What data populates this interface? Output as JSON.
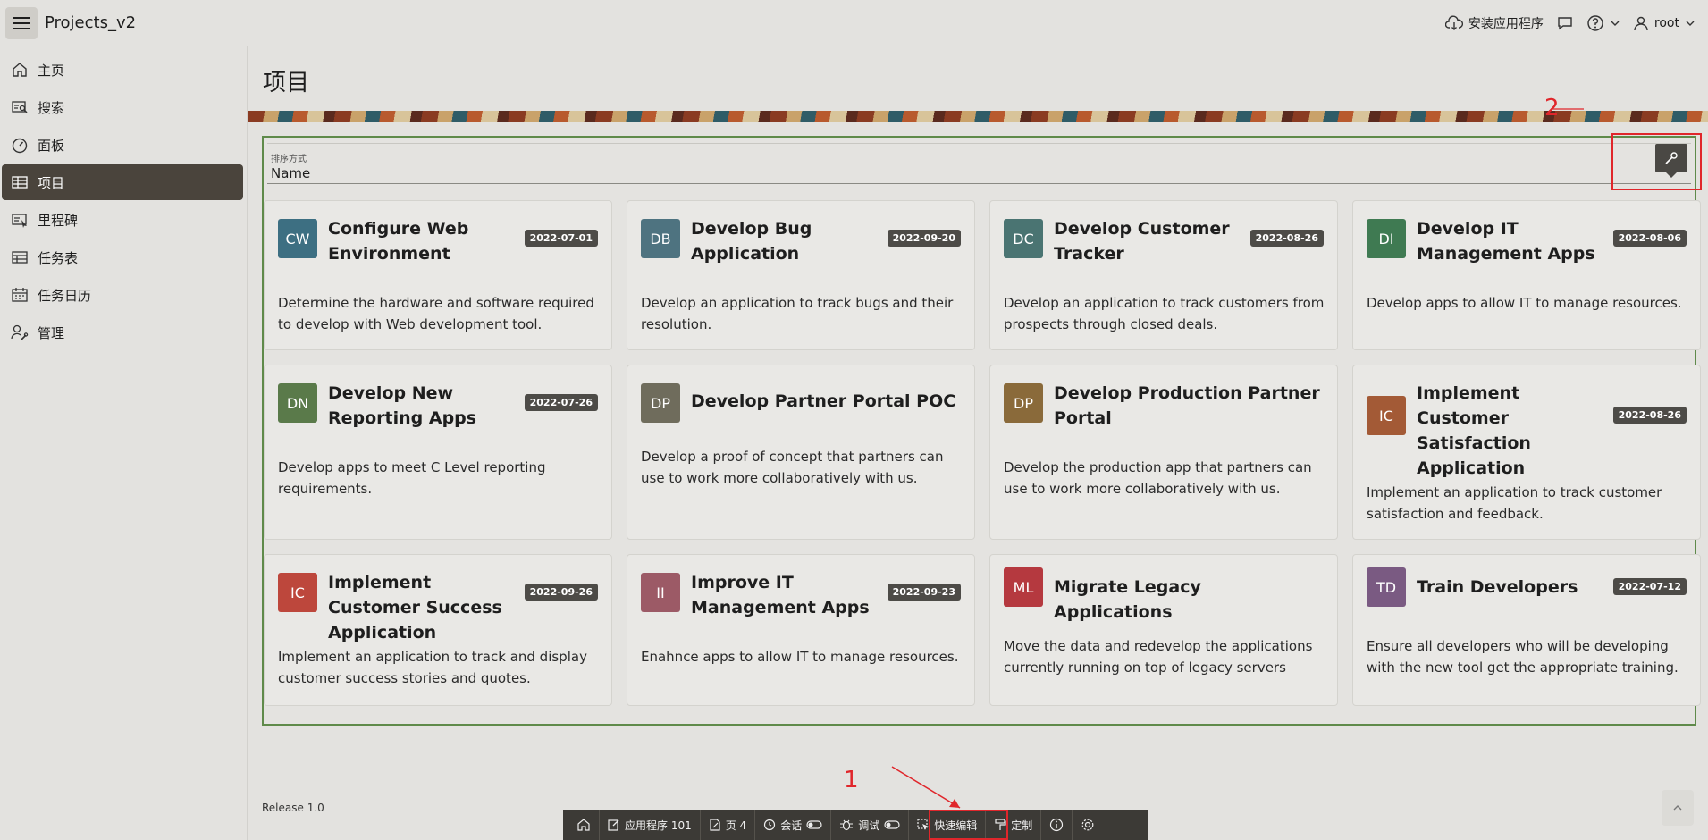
{
  "header": {
    "app_title": "Projects_v2",
    "install_label": "安装应用程序",
    "user_label": "root"
  },
  "sidebar": {
    "items": [
      {
        "label": "主页",
        "icon": "home-icon"
      },
      {
        "label": "搜索",
        "icon": "search-report-icon"
      },
      {
        "label": "面板",
        "icon": "dashboard-icon"
      },
      {
        "label": "项目",
        "icon": "table-icon",
        "active": true
      },
      {
        "label": "里程碑",
        "icon": "milestone-icon"
      },
      {
        "label": "任务表",
        "icon": "grid-icon"
      },
      {
        "label": "任务日历",
        "icon": "calendar-icon"
      },
      {
        "label": "管理",
        "icon": "user-wrench-icon"
      }
    ]
  },
  "main": {
    "page_title": "项目",
    "sort": {
      "label": "排序方式",
      "value": "Name"
    }
  },
  "cards": [
    {
      "initials": "CW",
      "title": "Configure Web Environment",
      "date": "2022-07-01",
      "desc": "Determine the hardware and software required to develop with Web development tool.",
      "color": "#3d6f82"
    },
    {
      "initials": "DB",
      "title": "Develop Bug Application",
      "date": "2022-09-20",
      "desc": "Develop an application to track bugs and their resolution.",
      "color": "#4e7380"
    },
    {
      "initials": "DC",
      "title": "Develop Customer Tracker",
      "date": "2022-08-26",
      "desc": "Develop an application to track customers from prospects through closed deals.",
      "color": "#4a7472"
    },
    {
      "initials": "DI",
      "title": "Develop IT Management Apps",
      "date": "2022-08-06",
      "desc": "Develop apps to allow IT to manage resources.",
      "color": "#3f7a52"
    },
    {
      "initials": "DN",
      "title": "Develop New Reporting Apps",
      "date": "2022-07-26",
      "desc": "Develop apps to meet C Level reporting requirements.",
      "color": "#5a7a4a"
    },
    {
      "initials": "DP",
      "title": "Develop Partner Portal POC",
      "date": "",
      "desc": "Develop a proof of concept that partners can use to work more collaboratively with us.",
      "color": "#6f6c5c"
    },
    {
      "initials": "DP",
      "title": "Develop Production Partner Portal",
      "date": "",
      "desc": "Develop the production app that partners can use to work more collaboratively with us.",
      "color": "#8a6a3a"
    },
    {
      "initials": "IC",
      "title": "Implement Customer Satisfaction Application",
      "date": "2022-08-26",
      "desc": "Implement an application to track customer satisfaction and feedback.",
      "color": "#a35a36"
    },
    {
      "initials": "IC",
      "title": "Implement Customer Success Application",
      "date": "2022-09-26",
      "desc": "Implement an application to track and display customer success stories and quotes.",
      "color": "#bd473c"
    },
    {
      "initials": "II",
      "title": "Improve IT Management Apps",
      "date": "2022-09-23",
      "desc": "Enahnce apps to allow IT to manage resources.",
      "color": "#9c5a66"
    },
    {
      "initials": "ML",
      "title": "Migrate Legacy Applications",
      "date": "",
      "desc": "Move the data and redevelop the applications currently running on top of legacy servers",
      "color": "#b5393f"
    },
    {
      "initials": "TD",
      "title": "Train Developers",
      "date": "2022-07-12",
      "desc": "Ensure all developers who will be developing with the new tool get the appropriate training.",
      "color": "#7a5a82"
    }
  ],
  "footer": {
    "release": "Release 1.0"
  },
  "devbar": {
    "app_label": "应用程序 101",
    "page_label": "页 4",
    "session_label": "会话",
    "debug_label": "调试",
    "quick_edit_label": "快速编辑",
    "customize_label": "定制"
  },
  "annotations": {
    "num1": "1",
    "num2": "2"
  }
}
